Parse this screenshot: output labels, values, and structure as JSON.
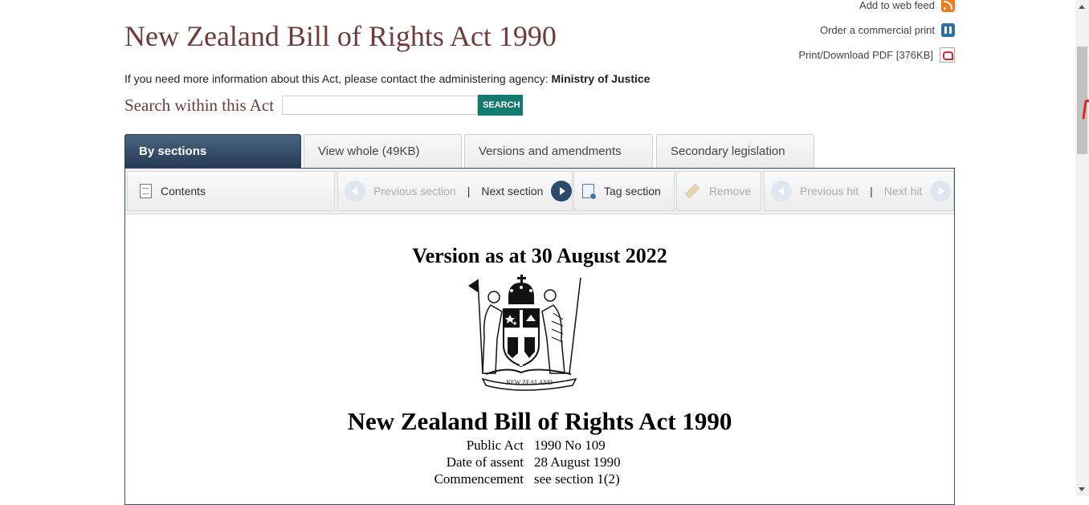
{
  "header": {
    "title": "New Zealand Bill of Rights Act 1990",
    "tools": {
      "web_feed": "Add to web feed",
      "commercial_print": "Order a commercial print",
      "pdf": "Print/Download PDF [376KB]"
    },
    "contact_prefix": "If you need more information about this Act, please contact the administering agency:",
    "contact_agency": "Ministry of Justice"
  },
  "search": {
    "label": "Search within this Act",
    "value": "",
    "button": "SEARCH"
  },
  "tabs": [
    {
      "label": "By sections",
      "active": true
    },
    {
      "label": "View whole (49KB)",
      "active": false
    },
    {
      "label": "Versions and amendments",
      "active": false
    },
    {
      "label": "Secondary legislation",
      "active": false
    }
  ],
  "toolbar": {
    "contents": "Contents",
    "previous_section": "Previous section",
    "separator": "|",
    "next_section": "Next section",
    "tag_section": "Tag section",
    "remove": "Remove",
    "previous_hit": "Previous hit",
    "next_hit": "Next hit"
  },
  "document": {
    "version": "Version as at 30 August 2022",
    "crest_text": "NEW ZEALAND",
    "act_title": "New Zealand Bill of Rights Act 1990",
    "meta": [
      {
        "label": "Public Act",
        "value": "1990 No 109"
      },
      {
        "label": "Date of assent",
        "value": "28 August 1990"
      },
      {
        "label": "Commencement",
        "value": "see section 1(2)"
      }
    ]
  },
  "icons": {
    "web_feed": "rss-icon",
    "print": "book-icon",
    "pdf": "pdf-icon",
    "contents": "document-icon",
    "tag": "tag-icon",
    "remove": "pencil-icon"
  },
  "colors": {
    "title": "#6e3b3b",
    "search_button": "#157a6e",
    "active_tab": "#243a55"
  }
}
